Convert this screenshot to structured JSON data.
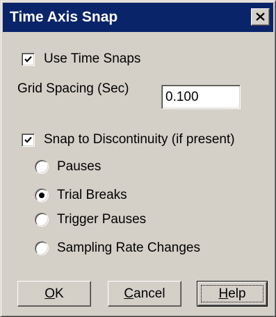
{
  "window": {
    "title": "Time Axis Snap",
    "close_icon": "close-x-icon"
  },
  "use_time_snaps": {
    "label": "Use Time Snaps",
    "checked": true
  },
  "grid_spacing": {
    "label": "Grid Spacing (Sec)",
    "value": "0.100"
  },
  "snap_to_discontinuity": {
    "label": "Snap to Discontinuity (if present)",
    "checked": true
  },
  "discontinuity_options": [
    {
      "label": "Pauses",
      "selected": false
    },
    {
      "label": "Trial Breaks",
      "selected": true
    },
    {
      "label": "Trigger Pauses",
      "selected": false
    },
    {
      "label": "Sampling Rate Changes",
      "selected": false
    }
  ],
  "buttons": {
    "ok": {
      "mnemonic": "O",
      "rest": "K"
    },
    "cancel": {
      "mnemonic": "C",
      "rest": "ancel"
    },
    "help": {
      "mnemonic": "H",
      "rest": "elp"
    }
  },
  "colors": {
    "dialog_face": "#d4d0c8",
    "titlebar": "#0a246a",
    "title_text": "#ffffff"
  }
}
